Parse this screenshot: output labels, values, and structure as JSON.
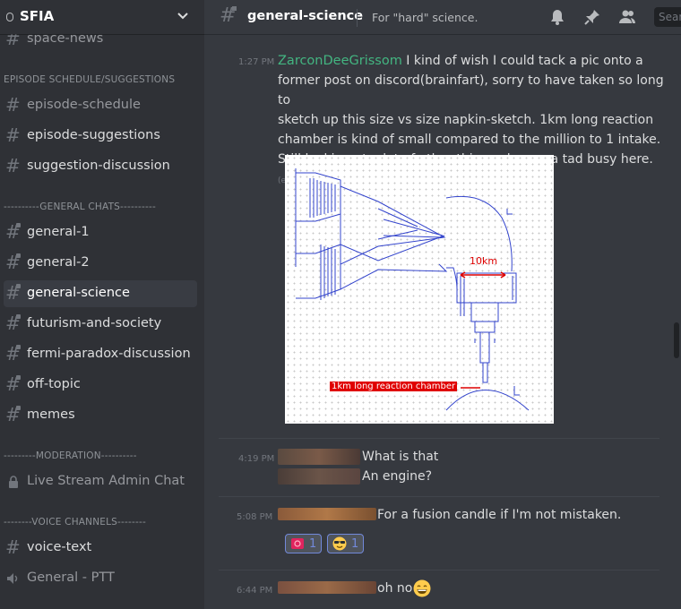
{
  "server": {
    "name": "SFIA",
    "badge": "0"
  },
  "sidebar": {
    "categories": [
      {
        "name": "EPISODE SCHEDULE/SUGGESTIONS"
      },
      {
        "name": "----------GENERAL CHATS----------"
      },
      {
        "name": "---------MODERATION----------"
      },
      {
        "name": "--------VOICE CHANNELS--------"
      }
    ],
    "channels": [
      {
        "label": "space-news"
      },
      {
        "label": "episode-schedule"
      },
      {
        "label": "episode-suggestions"
      },
      {
        "label": "suggestion-discussion"
      },
      {
        "label": "general-1"
      },
      {
        "label": "general-2"
      },
      {
        "label": "general-science"
      },
      {
        "label": "futurism-and-society"
      },
      {
        "label": "fermi-paradox-discussion"
      },
      {
        "label": "off-topic"
      },
      {
        "label": "memes"
      },
      {
        "label": "Live Stream Admin Chat"
      },
      {
        "label": "voice-text"
      },
      {
        "label": "General - PTT"
      }
    ]
  },
  "header": {
    "channel": "general-science",
    "topic": "For \"hard\" science.",
    "search_placeholder": "Search",
    "icons": [
      "bell-icon",
      "pin-icon",
      "members-icon"
    ]
  },
  "messages": [
    {
      "timestamp": "1:27 PM",
      "author": "ZarconDeeGrissom",
      "lines": [
        "I kind of wish I could tack a pic onto a",
        "former post on discord(brainfart), sorry to have taken so long to",
        "sketch up this size vs size napkin-sketch. 1km long reaction",
        "chamber is kind of small compared to the million to 1 intake.",
        "Still looking at a lot of other things also, so a tad busy here."
      ],
      "edited": "(edited)",
      "image": {
        "label_width": "10km",
        "label_chamber": "1km long reaction chamber"
      }
    },
    {
      "timestamp": "4:19 PM",
      "lines": [
        "What is that",
        "An engine?"
      ]
    },
    {
      "timestamp": "5:08 PM",
      "lines": [
        "For a fusion candle if I'm not mistaken."
      ],
      "reactions": [
        {
          "emoji": "heart-face-emoji",
          "count": "1"
        },
        {
          "emoji": "sunglasses-emoji",
          "count": "1"
        }
      ]
    },
    {
      "timestamp": "6:44 PM",
      "lines": [
        "oh no"
      ],
      "emoji": "grin-emoji"
    }
  ],
  "colors": {
    "accent": "#7289da",
    "author": "#43b581",
    "bg": "#36393f",
    "sidebar": "#2f3136"
  }
}
